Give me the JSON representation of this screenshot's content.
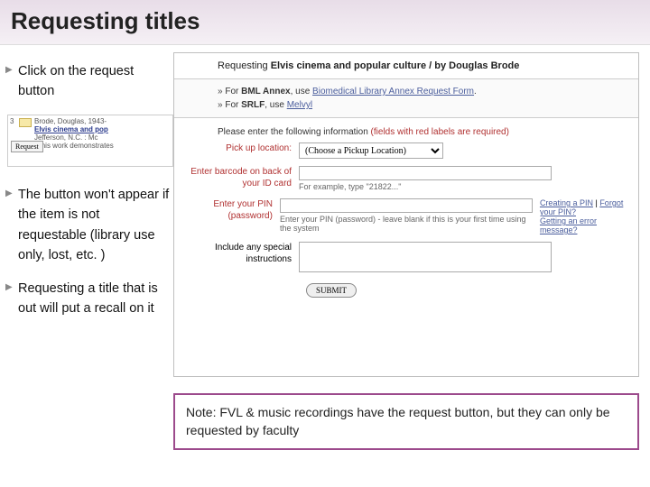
{
  "header": {
    "title": "Requesting titles"
  },
  "bullets": {
    "b1": "Click on the request button",
    "b2": "The button won't appear if the item is not requestable (library use only, lost, etc. )",
    "b3": "Requesting a title that is out will put a recall on it"
  },
  "catalog_snip": {
    "num": "3",
    "author": "Brode, Douglas, 1943-",
    "title": "Elvis cinema and pop",
    "pub": "Jefferson, N.C. : Mc",
    "desc": "\"This work demonstrates",
    "request_btn": "Request"
  },
  "form": {
    "head_prefix": "Requesting ",
    "head_bold": "Elvis cinema and popular culture / by Douglas Brode",
    "bml_prefix": "For ",
    "bml_bold": "BML Annex",
    "bml_mid": ", use ",
    "bml_link": "Biomedical Library Annex Request Form",
    "srlf_prefix": "For ",
    "srlf_bold": "SRLF",
    "srlf_mid": ", use ",
    "srlf_link": "Melvyl",
    "instr_a": "Please enter the following information ",
    "instr_b": "(fields with red labels are required)",
    "pickup_label": "Pick up location:",
    "pickup_option": "(Choose a Pickup Location)",
    "barcode_label": "Enter barcode on back of your ID card",
    "barcode_hint": "For example, type \"21822...\"",
    "pin_label": "Enter your PIN (password)",
    "pin_hint": "Enter your PIN (password) - leave blank if this is your first time using the system",
    "help_create": "Creating a PIN",
    "help_forgot": "Forgot your PIN?",
    "help_error": "Getting an error message?",
    "special_label": "Include any special instructions",
    "submit": "SUBMIT"
  },
  "note": "Note: FVL & music recordings have the request button, but they can only be requested by faculty"
}
